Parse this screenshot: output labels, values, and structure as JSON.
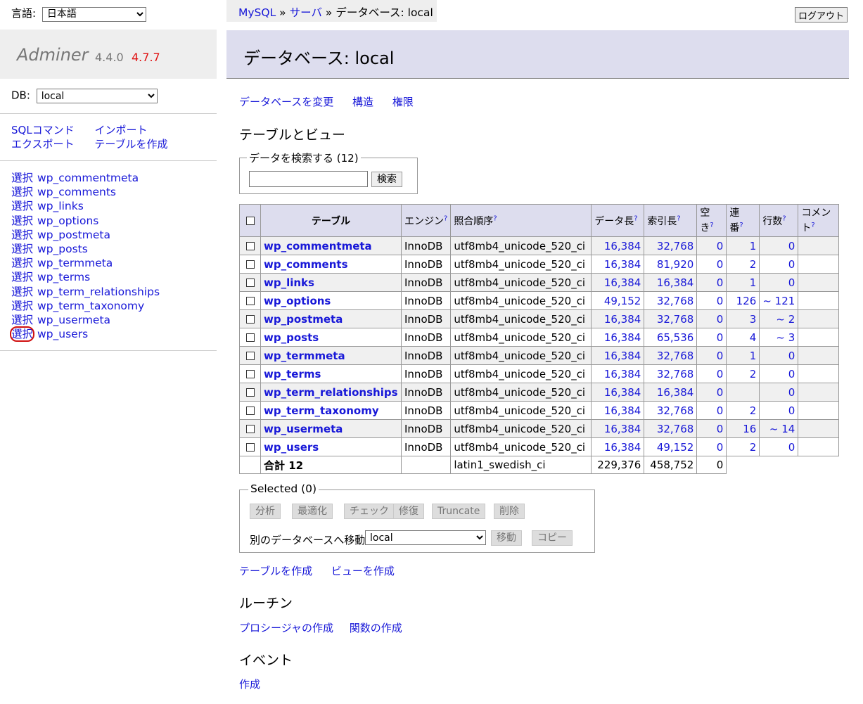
{
  "sidebar": {
    "lang_label": "言語:",
    "lang_value": "日本語",
    "logo_name": "Adminer",
    "version": "4.4.0",
    "new_version": "4.7.7",
    "db_label": "DB:",
    "db_value": "local",
    "commands": [
      "SQLコマンド",
      "インポート",
      "エクスポート",
      "テーブルを作成"
    ],
    "select_label": "選択",
    "tables": [
      "wp_commentmeta",
      "wp_comments",
      "wp_links",
      "wp_options",
      "wp_postmeta",
      "wp_posts",
      "wp_termmeta",
      "wp_terms",
      "wp_term_relationships",
      "wp_term_taxonomy",
      "wp_usermeta",
      "wp_users"
    ]
  },
  "breadcrumb": {
    "mysql": "MySQL",
    "sep": "»",
    "server": "サーバ",
    "current": "データベース: local"
  },
  "logout_label": "ログアウト",
  "page_title": "データベース: local",
  "db_links": [
    "データベースを変更",
    "構造",
    "権限"
  ],
  "tables_heading": "テーブルとビュー",
  "search": {
    "legend": "データを検索する (12)",
    "value": "",
    "button": "検索"
  },
  "table": {
    "headers": {
      "table": "テーブル",
      "engine": "エンジン",
      "collation": "照合順序",
      "data_length": "データ長",
      "index_length": "索引長",
      "free_1": "空",
      "free_2": "き",
      "auto_inc_1": "連",
      "auto_inc_2": "番",
      "rows": "行数",
      "comment_1": "コメン",
      "comment_2": "ト"
    },
    "help_mark": "?",
    "rows": [
      {
        "name": "wp_commentmeta",
        "engine": "InnoDB",
        "collation": "utf8mb4_unicode_520_ci",
        "data": "16,384",
        "index": "32,768",
        "free": "0",
        "auto": "1",
        "rows": "0"
      },
      {
        "name": "wp_comments",
        "engine": "InnoDB",
        "collation": "utf8mb4_unicode_520_ci",
        "data": "16,384",
        "index": "81,920",
        "free": "0",
        "auto": "2",
        "rows": "0"
      },
      {
        "name": "wp_links",
        "engine": "InnoDB",
        "collation": "utf8mb4_unicode_520_ci",
        "data": "16,384",
        "index": "16,384",
        "free": "0",
        "auto": "1",
        "rows": "0"
      },
      {
        "name": "wp_options",
        "engine": "InnoDB",
        "collation": "utf8mb4_unicode_520_ci",
        "data": "49,152",
        "index": "32,768",
        "free": "0",
        "auto": "126",
        "rows": "~ 121"
      },
      {
        "name": "wp_postmeta",
        "engine": "InnoDB",
        "collation": "utf8mb4_unicode_520_ci",
        "data": "16,384",
        "index": "32,768",
        "free": "0",
        "auto": "3",
        "rows": "~ 2"
      },
      {
        "name": "wp_posts",
        "engine": "InnoDB",
        "collation": "utf8mb4_unicode_520_ci",
        "data": "16,384",
        "index": "65,536",
        "free": "0",
        "auto": "4",
        "rows": "~ 3"
      },
      {
        "name": "wp_termmeta",
        "engine": "InnoDB",
        "collation": "utf8mb4_unicode_520_ci",
        "data": "16,384",
        "index": "32,768",
        "free": "0",
        "auto": "1",
        "rows": "0"
      },
      {
        "name": "wp_terms",
        "engine": "InnoDB",
        "collation": "utf8mb4_unicode_520_ci",
        "data": "16,384",
        "index": "32,768",
        "free": "0",
        "auto": "2",
        "rows": "0"
      },
      {
        "name": "wp_term_relationships",
        "engine": "InnoDB",
        "collation": "utf8mb4_unicode_520_ci",
        "data": "16,384",
        "index": "16,384",
        "free": "0",
        "auto": "",
        "rows": "0"
      },
      {
        "name": "wp_term_taxonomy",
        "engine": "InnoDB",
        "collation": "utf8mb4_unicode_520_ci",
        "data": "16,384",
        "index": "32,768",
        "free": "0",
        "auto": "2",
        "rows": "0"
      },
      {
        "name": "wp_usermeta",
        "engine": "InnoDB",
        "collation": "utf8mb4_unicode_520_ci",
        "data": "16,384",
        "index": "32,768",
        "free": "0",
        "auto": "16",
        "rows": "~ 14"
      },
      {
        "name": "wp_users",
        "engine": "InnoDB",
        "collation": "utf8mb4_unicode_520_ci",
        "data": "16,384",
        "index": "49,152",
        "free": "0",
        "auto": "2",
        "rows": "0"
      }
    ],
    "footer": {
      "label": "合計 12",
      "collation": "latin1_swedish_ci",
      "data": "229,376",
      "index": "458,752",
      "free": "0"
    }
  },
  "selected": {
    "legend": "Selected (0)",
    "buttons": [
      "分析",
      "最適化",
      "チェック",
      "修復",
      "Truncate",
      "削除"
    ],
    "move_label": "別のデータベースへ移動:",
    "move_db": "local",
    "move_button": "移動",
    "copy_button": "コピー"
  },
  "create_links": [
    "テーブルを作成",
    "ビューを作成"
  ],
  "routines_heading": "ルーチン",
  "routine_links": [
    "プロシージャの作成",
    "関数の作成"
  ],
  "events_heading": "イベント",
  "event_link": "作成"
}
